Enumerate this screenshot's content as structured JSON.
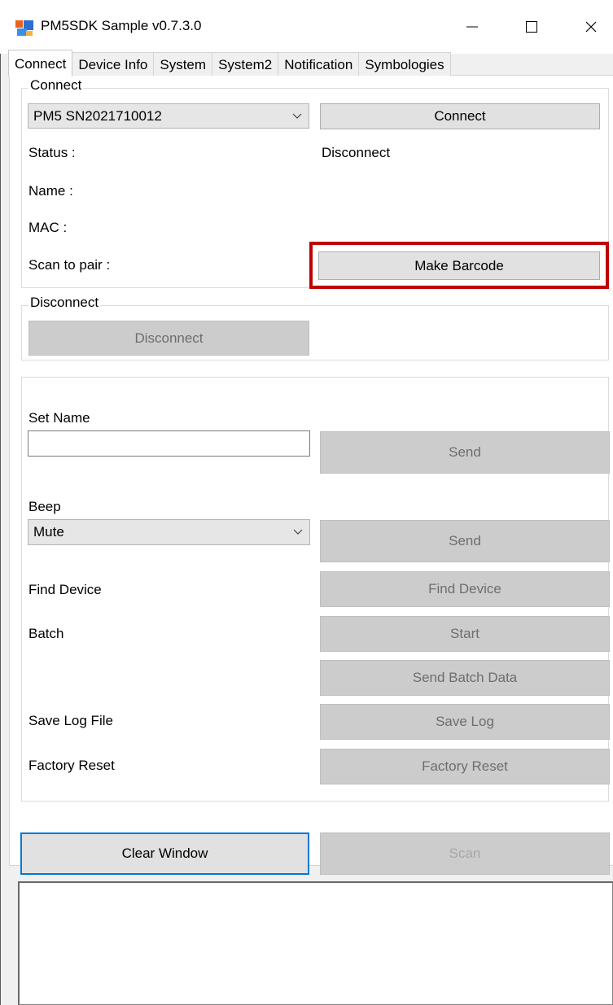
{
  "window": {
    "title": "PM5SDK Sample v0.7.3.0",
    "minimize_icon": "minimize-icon",
    "maximize_icon": "maximize-icon",
    "close_icon": "close-icon"
  },
  "tabs": [
    {
      "label": "Connect",
      "active": true
    },
    {
      "label": "Device Info"
    },
    {
      "label": "System"
    },
    {
      "label": "System2"
    },
    {
      "label": "Notification"
    },
    {
      "label": "Symbologies"
    }
  ],
  "connect_group": {
    "title": "Connect",
    "device_select": "PM5 SN2021710012",
    "connect_button": "Connect",
    "status_label": "Status :",
    "status_value": "Disconnect",
    "name_label": "Name :",
    "mac_label": "MAC :",
    "scan_to_pair_label": "Scan to pair :",
    "make_barcode_button": "Make Barcode"
  },
  "disconnect_group": {
    "title": "Disconnect",
    "disconnect_button": "Disconnect"
  },
  "settings": {
    "set_name_label": "Set Name",
    "set_name_value": "",
    "set_name_send": "Send",
    "beep_label": "Beep",
    "beep_select": "Mute",
    "beep_send": "Send",
    "find_device_label": "Find Device",
    "find_device_button": "Find Device",
    "batch_label": "Batch",
    "batch_start_button": "Start",
    "send_batch_button": "Send Batch Data",
    "save_log_label": "Save Log File",
    "save_log_button": "Save Log",
    "factory_reset_label": "Factory Reset",
    "factory_reset_button": "Factory Reset"
  },
  "bottom": {
    "clear_window_button": "Clear Window",
    "scan_button": "Scan",
    "log_text": ""
  },
  "colors": {
    "highlight": "#c00000",
    "focus": "#0078d7"
  }
}
